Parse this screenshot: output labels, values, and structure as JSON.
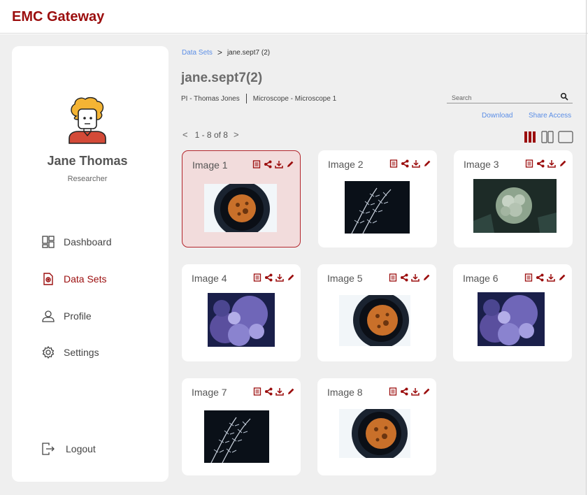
{
  "app": {
    "title": "EMC Gateway"
  },
  "user": {
    "name": "Jane Thomas",
    "role": "Researcher"
  },
  "nav": [
    {
      "label": "Dashboard",
      "icon": "dashboard-icon",
      "active": false
    },
    {
      "label": "Data Sets",
      "icon": "dataset-icon",
      "active": true
    },
    {
      "label": "Profile",
      "icon": "user-icon",
      "active": false
    },
    {
      "label": "Settings",
      "icon": "gear-icon",
      "active": false
    }
  ],
  "logout_label": "Logout",
  "breadcrumb": {
    "root": "Data Sets",
    "separator": ">",
    "current": "jane.sept7 (2)"
  },
  "dataset": {
    "title": "jane.sept7(2)",
    "pi": "PI - Thomas Jones",
    "microscope": "Microscope - Microscope 1"
  },
  "search": {
    "placeholder": "Search",
    "value": ""
  },
  "actions": {
    "download": "Download",
    "share": "Share Access"
  },
  "pagination": {
    "prev": "<",
    "text": "1 - 8 of 8",
    "next": ">"
  },
  "view_modes": [
    "three-column-view",
    "two-column-view",
    "single-column-view"
  ],
  "active_view": "three-column-view",
  "images": [
    {
      "title": "Image 1",
      "kind": "microscope",
      "selected": true
    },
    {
      "title": "Image 2",
      "kind": "plant-dark",
      "selected": false
    },
    {
      "title": "Image 3",
      "kind": "flower-green",
      "selected": false
    },
    {
      "title": "Image 4",
      "kind": "purple-blossom",
      "selected": false
    },
    {
      "title": "Image 5",
      "kind": "microscope",
      "selected": false
    },
    {
      "title": "Image 6",
      "kind": "purple-blossom",
      "selected": false
    },
    {
      "title": "Image 7",
      "kind": "plant-dark",
      "selected": false
    },
    {
      "title": "Image 8",
      "kind": "microscope",
      "selected": false
    }
  ],
  "card_actions": [
    "notes-icon",
    "share-icon",
    "download-icon",
    "edit-icon"
  ],
  "colors": {
    "brand": "#9b0d0d",
    "link": "#5b8ee6",
    "background": "#efefef",
    "selected_card": "#f2dcdc"
  }
}
